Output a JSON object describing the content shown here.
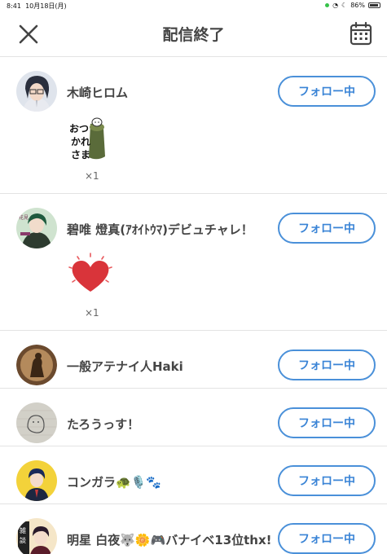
{
  "status_bar": {
    "time": "8:41",
    "date": "10月18日(月)",
    "battery": "86%"
  },
  "header": {
    "title": "配信終了",
    "close_icon": "close-icon",
    "calendar_icon": "calendar-icon"
  },
  "colors": {
    "accent": "#4a90d9",
    "divider": "#e3e3e3"
  },
  "viewers": [
    {
      "name": "木崎ヒロム",
      "follow_label": "フォロー中",
      "gift": {
        "name": "おつかれさま",
        "count": "×1"
      }
    },
    {
      "name": "碧唯 燈真(ｱｵｲﾄｳﾏ)デビュチャレ！",
      "follow_label": "フォロー中",
      "gift": {
        "name": "heart",
        "count": "×1"
      }
    },
    {
      "name": "一般アテナイ人Haki",
      "follow_label": "フォロー中"
    },
    {
      "name": "たろうっす！",
      "follow_label": "フォロー中"
    },
    {
      "name": "コンガラ🐢🎙️🐾",
      "follow_label": "フォロー中"
    },
    {
      "name": "明星 白夜🐺🌼🎮バナイベ13位thx!!",
      "follow_label": "フォロー中"
    }
  ]
}
